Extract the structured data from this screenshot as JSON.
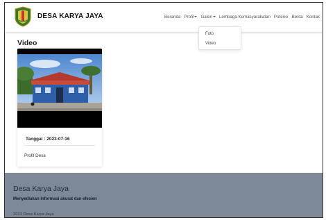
{
  "brand": {
    "name": "DESA KARYA JAYA"
  },
  "nav": {
    "items": [
      {
        "label": "Beranda",
        "has_dropdown": false
      },
      {
        "label": "Profil",
        "has_dropdown": true
      },
      {
        "label": "Galeri",
        "has_dropdown": true
      },
      {
        "label": "Lembaga Kemasyarakatan",
        "has_dropdown": false
      },
      {
        "label": "Potensi",
        "has_dropdown": false
      },
      {
        "label": "Berita",
        "has_dropdown": false
      },
      {
        "label": "Kontak",
        "has_dropdown": false
      }
    ],
    "galeri_dropdown": [
      "Foto",
      "Video"
    ]
  },
  "page": {
    "heading": "Video"
  },
  "cards": [
    {
      "date": "Tanggal : 2023-07-16",
      "tag": "Profil Desa"
    }
  ],
  "footer": {
    "title": "Desa Karya Jaya",
    "tagline": "Menyediakan Informasi akurat dan efesien",
    "copyright": "2023 Desa Karya Jaya"
  },
  "colors": {
    "footer_bg": "#7d8998",
    "nav_text": "#555555"
  }
}
